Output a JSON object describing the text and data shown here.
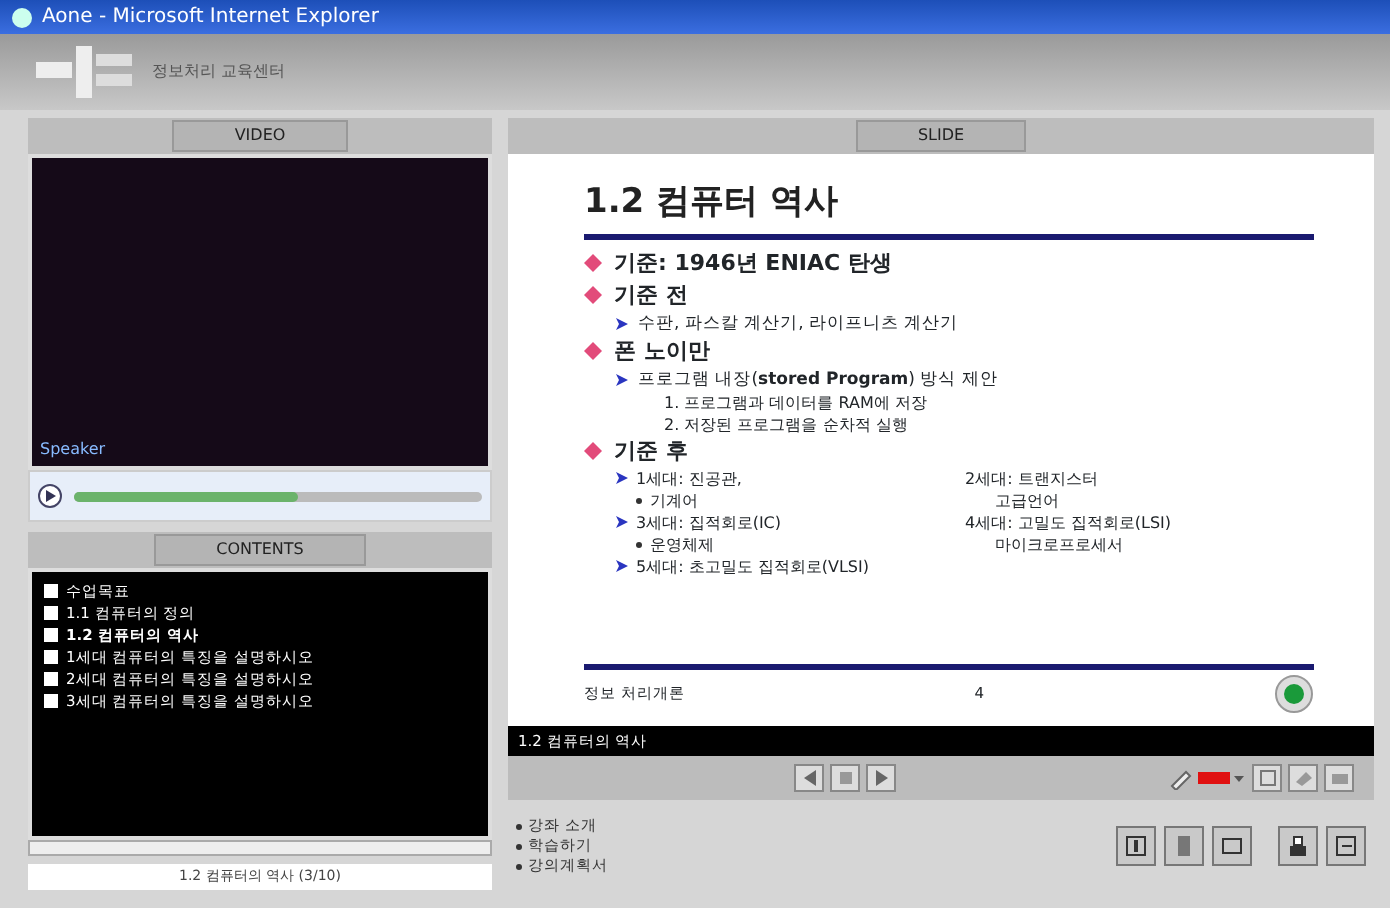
{
  "window": {
    "title": "Aone - Microsoft Internet Explorer"
  },
  "header": {
    "caption": "정보처리 교육센터"
  },
  "video_panel": {
    "tab_label": "VIDEO",
    "speaker": "Speaker",
    "level": 0.55
  },
  "contents_panel": {
    "tab_label": "CONTENTS",
    "items": [
      {
        "label": "수업목표",
        "selected": false
      },
      {
        "label": "1.1 컴퓨터의 정의",
        "selected": false
      },
      {
        "label": "1.2 컴퓨터의 역사",
        "selected": true
      },
      {
        "label": "1세대 컴퓨터의 특징을 설명하시오",
        "selected": false
      },
      {
        "label": "2세대 컴퓨터의 특징을 설명하시오",
        "selected": false
      },
      {
        "label": "3세대 컴퓨터의 특징을 설명하시오",
        "selected": false
      }
    ],
    "status": "1.2 컴퓨터의 역사 (3/10)"
  },
  "slide_panel": {
    "tab_label": "SLIDE",
    "title": "1.2 컴퓨터 역사",
    "bullets": [
      {
        "text": "기준: 1946년 ENIAC 탄생"
      },
      {
        "text": "기준 전",
        "children": [
          {
            "text": "수판, 파스칼 계산기, 라이프니츠 계산기"
          }
        ]
      },
      {
        "text": "폰 노이만",
        "children": [
          {
            "text": "프로그램 내장(**stored Program**) 방식 제안",
            "children": [
              {
                "text": "1. 프로그램과 데이터를 RAM에 저장"
              },
              {
                "text": "2. 저장된 프로그램을 순차적 실행"
              }
            ]
          }
        ]
      },
      {
        "text": "기준 후"
      }
    ],
    "generations": [
      {
        "left": "1세대: 진공관,",
        "left_sub": "기계어",
        "right": "2세대: 트랜지스터",
        "right_sub": "고급언어"
      },
      {
        "left": "3세대: 집적회로(IC)",
        "left_sub": "운영체제",
        "right": "4세대: 고밀도 집적회로(LSI)",
        "right_sub": "마이크로프로세서"
      },
      {
        "left": "5세대: 초고밀도 집적회로(VLSI)"
      }
    ],
    "footer": "정보 처리개론",
    "footer_mark": "4",
    "caption": "1.2 컴퓨터의 역사"
  },
  "bottom_links": [
    "강좌 소개",
    "학습하기",
    "강의계획서"
  ]
}
